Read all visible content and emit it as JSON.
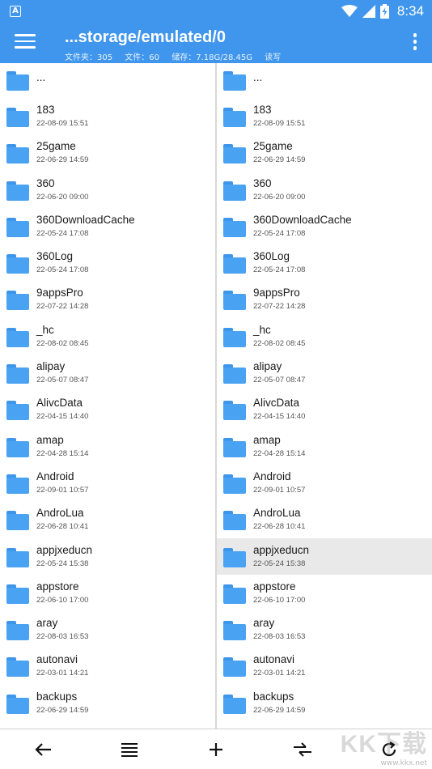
{
  "status_bar": {
    "app_icon_letter": "A",
    "time": "8:34",
    "icons": [
      "wifi-icon",
      "signal-icon",
      "battery-charging-icon"
    ]
  },
  "app_bar": {
    "title": "...storage/emulated/0",
    "info": {
      "folders": "文件夹：305",
      "files": "文件：60",
      "storage": "储存：7.18G/28.45G",
      "mode": "读写"
    },
    "accent_color": "#3f96ec"
  },
  "left_pane": {
    "items": [
      {
        "name": "...",
        "date": ""
      },
      {
        "name": "183",
        "date": "22-08-09 15:51"
      },
      {
        "name": "25game",
        "date": "22-06-29 14:59"
      },
      {
        "name": "360",
        "date": "22-06-20 09:00"
      },
      {
        "name": "360DownloadCache",
        "date": "22-05-24 17:08"
      },
      {
        "name": "360Log",
        "date": "22-05-24 17:08"
      },
      {
        "name": "9appsPro",
        "date": "22-07-22 14:28"
      },
      {
        "name": "_hc",
        "date": "22-08-02 08:45"
      },
      {
        "name": "alipay",
        "date": "22-05-07 08:47"
      },
      {
        "name": "AlivcData",
        "date": "22-04-15 14:40"
      },
      {
        "name": "amap",
        "date": "22-04-28 15:14"
      },
      {
        "name": "Android",
        "date": "22-09-01 10:57"
      },
      {
        "name": "AndroLua",
        "date": "22-06-28 10:41"
      },
      {
        "name": "appjxeducn",
        "date": "22-05-24 15:38"
      },
      {
        "name": "appstore",
        "date": "22-06-10 17:00"
      },
      {
        "name": "aray",
        "date": "22-08-03 16:53"
      },
      {
        "name": "autonavi",
        "date": "22-03-01 14:21"
      },
      {
        "name": "backups",
        "date": "22-06-29 14:59"
      }
    ]
  },
  "right_pane": {
    "selected_item": "appjxeducn",
    "items": [
      {
        "name": "...",
        "date": ""
      },
      {
        "name": "183",
        "date": "22-08-09 15:51"
      },
      {
        "name": "25game",
        "date": "22-06-29 14:59"
      },
      {
        "name": "360",
        "date": "22-06-20 09:00"
      },
      {
        "name": "360DownloadCache",
        "date": "22-05-24 17:08"
      },
      {
        "name": "360Log",
        "date": "22-05-24 17:08"
      },
      {
        "name": "9appsPro",
        "date": "22-07-22 14:28"
      },
      {
        "name": "_hc",
        "date": "22-08-02 08:45"
      },
      {
        "name": "alipay",
        "date": "22-05-07 08:47"
      },
      {
        "name": "AlivcData",
        "date": "22-04-15 14:40"
      },
      {
        "name": "amap",
        "date": "22-04-28 15:14"
      },
      {
        "name": "Android",
        "date": "22-09-01 10:57"
      },
      {
        "name": "AndroLua",
        "date": "22-06-28 10:41"
      },
      {
        "name": "appjxeducn",
        "date": "22-05-24 15:38"
      },
      {
        "name": "appstore",
        "date": "22-06-10 17:00"
      },
      {
        "name": "aray",
        "date": "22-08-03 16:53"
      },
      {
        "name": "autonavi",
        "date": "22-03-01 14:21"
      },
      {
        "name": "backups",
        "date": "22-06-29 14:59"
      }
    ]
  },
  "toolbar": {
    "buttons": [
      "back-arrow-icon",
      "list-view-icon",
      "add-icon",
      "swap-panes-icon",
      "refresh-icon"
    ]
  },
  "watermark": {
    "big": "KK下载",
    "small": "www.kkx.net"
  },
  "colors": {
    "folder": "#4aa2f2",
    "selected_row": "#e9e9e9"
  }
}
